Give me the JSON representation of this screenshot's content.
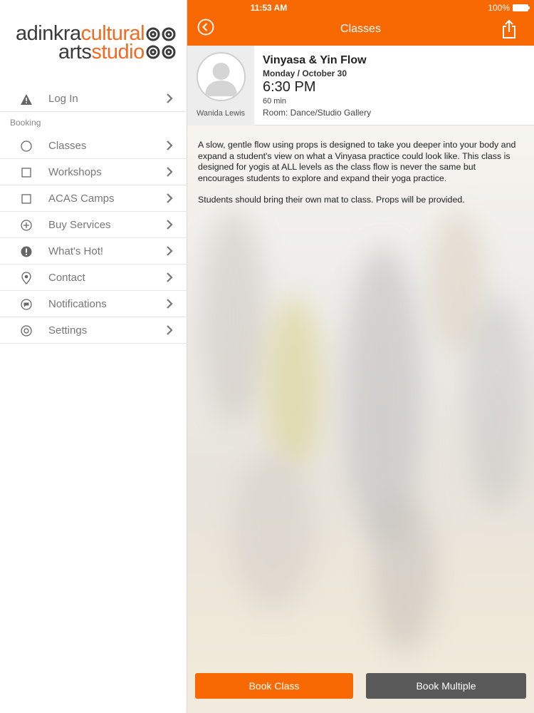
{
  "status_bar": {
    "time": "11:53 AM",
    "battery": "100%"
  },
  "logo": {
    "line1_dark": "adinkra",
    "line1_orange": "cultural",
    "line2_dark": "arts",
    "line2_orange": "studio"
  },
  "sidebar": {
    "login": {
      "label": "Log In",
      "icon": "warning-icon"
    },
    "section_label": "Booking",
    "items": [
      {
        "label": "Classes",
        "icon": "circle-icon"
      },
      {
        "label": "Workshops",
        "icon": "square-icon"
      },
      {
        "label": "ACAS Camps",
        "icon": "square-icon"
      },
      {
        "label": "Buy Services",
        "icon": "plus-circle-icon"
      },
      {
        "label": "What's Hot!",
        "icon": "alert-icon"
      },
      {
        "label": "Contact",
        "icon": "location-pin-icon"
      },
      {
        "label": "Notifications",
        "icon": "chat-bubble-icon"
      },
      {
        "label": "Settings",
        "icon": "gear-icon"
      }
    ]
  },
  "header": {
    "title": "Classes"
  },
  "class_detail": {
    "instructor": "Wanida Lewis",
    "name": "Vinyasa & Yin Flow",
    "date": "Monday / October 30",
    "time": "6:30 PM",
    "duration": "60 min",
    "room": "Room: Dance/Studio Gallery"
  },
  "description": {
    "p1": "A slow, gentle flow using props is designed to take you deeper into your body and expand a student's view on what a Vinyasa practice could look like. This class is designed for yogis at ALL levels as the class flow is never the same but encourages students to explore and expand their yoga practice.",
    "p2": "Students should bring their own mat to class. Props will be provided."
  },
  "buttons": {
    "book_class": "Book Class",
    "book_multiple": "Book Multiple"
  },
  "colors": {
    "accent": "#f86904",
    "secondary_button": "#595959"
  }
}
